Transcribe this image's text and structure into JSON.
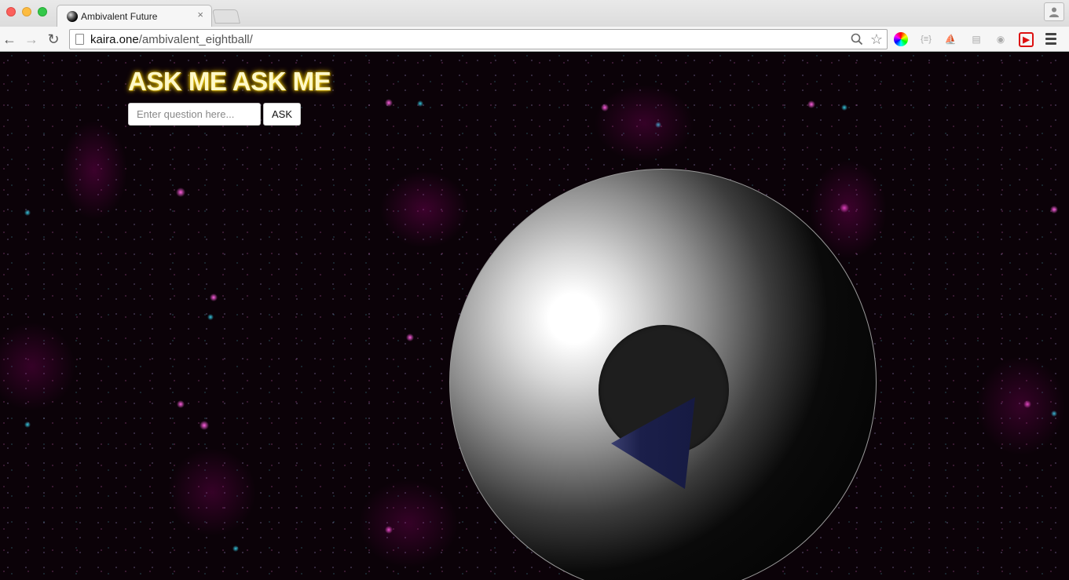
{
  "browser": {
    "tab": {
      "title": "Ambivalent Future",
      "close_glyph": "×"
    },
    "address": {
      "host": "kaira.one",
      "path": "/ambivalent_eightball/"
    },
    "extensions": {
      "json_label": "{≡}"
    }
  },
  "page": {
    "title": "ASK ME ASK ME",
    "question_input": {
      "placeholder": "Enter question here...",
      "value": ""
    },
    "ask_button_label": "ASK"
  },
  "colors": {
    "title_text": "#fff8c8",
    "title_glow": "#e8c600",
    "triangle": "#1b1f4a",
    "background_magenta": "#ff5fe0",
    "background_cyan": "#35c8e0"
  },
  "icons": [
    "eight-ball-favicon-icon",
    "page-icon",
    "back-arrow-icon",
    "forward-arrow-icon",
    "reload-icon",
    "search-icon",
    "star-icon",
    "color-wheel-icon",
    "json-icon",
    "ship-icon",
    "cast-icon",
    "camera-icon",
    "flash-icon",
    "menu-icon",
    "profile-icon"
  ]
}
